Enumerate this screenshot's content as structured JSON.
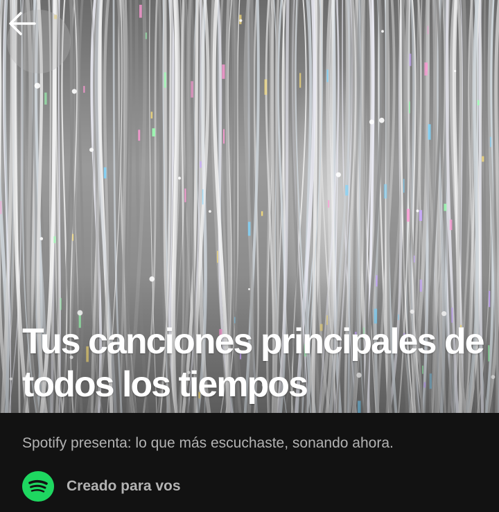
{
  "header": {
    "back_icon": "arrow-left-icon"
  },
  "hero": {
    "image_description_icon": "tinsel-curtain-cover-image",
    "title": "Tus canciones principales de todos los tiempos"
  },
  "info": {
    "description": "Spotify presenta: lo que más escuchaste, sonando ahora.",
    "creator_icon": "spotify-logo-icon",
    "creator_label": "Creado para vos"
  },
  "colors": {
    "background": "#121212",
    "accent": "#1ed760",
    "title_text": "#ffffff",
    "secondary_text": "#b3b3b3"
  }
}
